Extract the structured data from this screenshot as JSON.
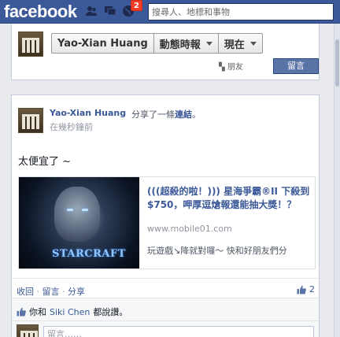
{
  "topbar": {
    "logo": "facebook",
    "notification_count": "2",
    "search_placeholder": "搜尋人、地標和事物"
  },
  "profile_header": {
    "name": "Yao-Xian Huang",
    "filter_label": "動態時報",
    "time_label": "現在",
    "friend_button": "朋友",
    "message_button": "留言"
  },
  "post": {
    "author": "Yao-Xian Huang",
    "action_prefix": "分享了一條",
    "action_link": "連結",
    "action_suffix": "。",
    "time": "在幾秒鐘前",
    "text": "太便宜了 ~",
    "attachment": {
      "thumb_logo": "STARCRAFT",
      "title": "(((超殺的啦！))) 星海爭霸®II 下殺到$750，呷厚逗熗報還能抽大獎！？",
      "domain": "www.mobile01.com",
      "description": "玩遊戲↘降就對囉～ 快和好朋友們分"
    },
    "actions": {
      "collect": "收回",
      "comment": "留言",
      "share": "分享",
      "separator": "·"
    },
    "like_count": "2",
    "likes": {
      "prefix": "你和",
      "name": "Siki Chen",
      "suffix": "都說讚。"
    },
    "comment_placeholder": "留言……"
  },
  "colors": {
    "brand_blue": "#3b5998",
    "notification_red": "#f03d25",
    "link_blue": "#3b5998"
  }
}
